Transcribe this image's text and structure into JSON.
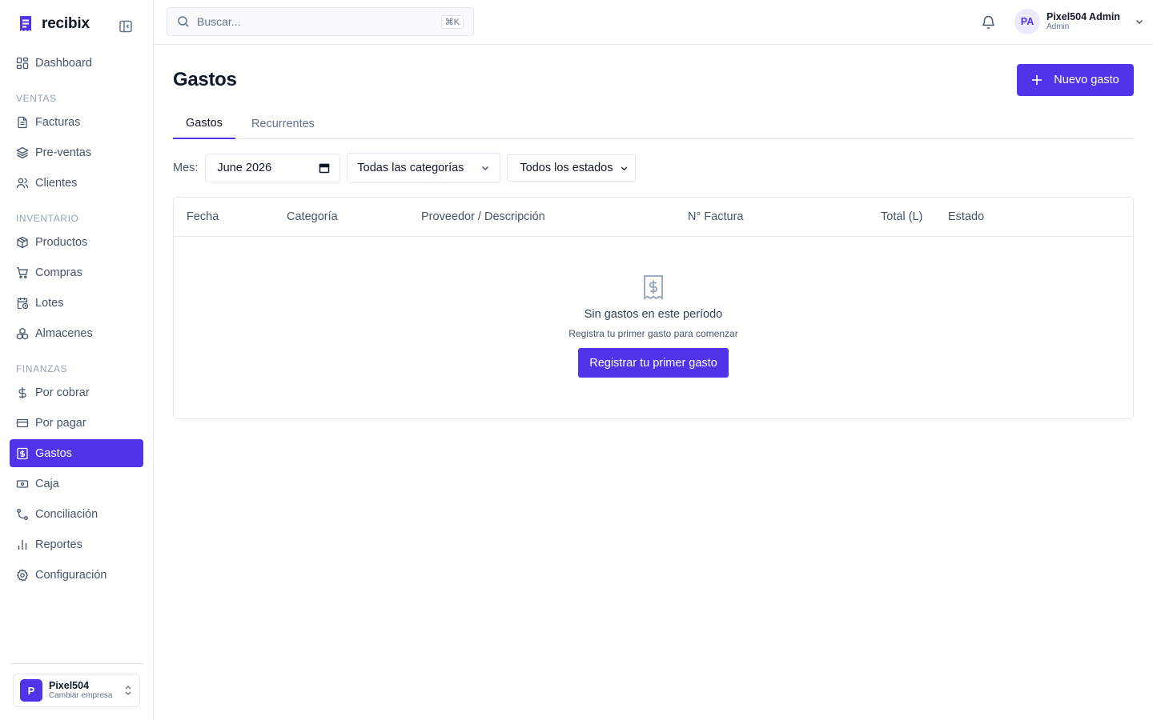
{
  "brand": {
    "name": "recibix",
    "accent": "#5034ea"
  },
  "sidebar": {
    "items": [
      {
        "label": "Dashboard",
        "icon": "dashboard-icon"
      },
      {
        "section": "VENTAS"
      },
      {
        "label": "Facturas",
        "icon": "file-text-icon"
      },
      {
        "label": "Pre-ventas",
        "icon": "layers-icon"
      },
      {
        "label": "Clientes",
        "icon": "users-icon"
      },
      {
        "section": "INVENTARIO"
      },
      {
        "label": "Productos",
        "icon": "package-icon"
      },
      {
        "label": "Compras",
        "icon": "cart-icon"
      },
      {
        "label": "Lotes",
        "icon": "calendar-clock-icon"
      },
      {
        "label": "Almacenes",
        "icon": "boxes-icon"
      },
      {
        "section": "FINANZAS"
      },
      {
        "label": "Por cobrar",
        "icon": "dollar-icon"
      },
      {
        "label": "Por pagar",
        "icon": "credit-card-icon"
      },
      {
        "label": "Gastos",
        "icon": "receipt-dollar-icon",
        "active": true
      },
      {
        "label": "Caja",
        "icon": "banknote-icon"
      },
      {
        "label": "Conciliación",
        "icon": "git-branch-icon"
      },
      {
        "label": "Reportes",
        "icon": "bar-chart-icon"
      },
      {
        "label": "Configuración",
        "icon": "gear-icon"
      }
    ]
  },
  "company": {
    "initial": "P",
    "name": "Pixel504",
    "switch_label": "Cambiar empresa"
  },
  "topbar": {
    "search_placeholder": "Buscar...",
    "shortcut": "⌘K",
    "user": {
      "initials": "PA",
      "name": "Pixel504 Admin",
      "role": "Admin"
    }
  },
  "page": {
    "title": "Gastos",
    "new_button": "Nuevo gasto",
    "tabs": [
      {
        "label": "Gastos",
        "active": true
      },
      {
        "label": "Recurrentes"
      }
    ],
    "filters": {
      "month_label": "Mes:",
      "month_value": "June 2026",
      "category": "Todas las categorías",
      "status": "Todos los estados"
    },
    "table": {
      "columns": [
        "Fecha",
        "Categoría",
        "Proveedor / Descripción",
        "N° Factura",
        "Total (L)",
        "Estado"
      ],
      "empty_title": "Sin gastos en este período",
      "empty_subtitle": "Registra tu primer gasto para comenzar",
      "empty_button": "Registrar tu primer gasto"
    }
  }
}
